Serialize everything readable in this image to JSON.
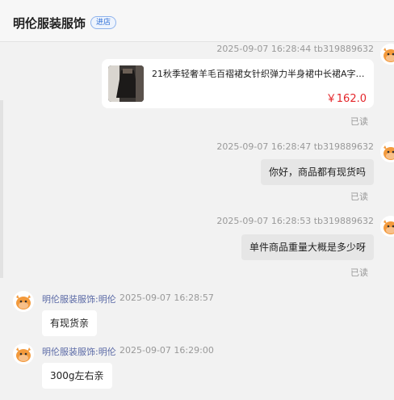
{
  "header": {
    "shop_name": "明伦服装服饰",
    "enter_shop_label": "进店"
  },
  "messages": [
    {
      "type": "product",
      "meta": "2025-09-07 16:28:44  tb319889632",
      "product_title": "21秋季轻奢羊毛百褶裙女针织弹力半身裙中长裙A字羊...",
      "price": "￥162.0",
      "read": "已读"
    },
    {
      "type": "text",
      "meta": "2025-09-07 16:28:47  tb319889632",
      "text": "你好，商品都有现货吗",
      "read": "已读"
    },
    {
      "type": "text",
      "meta": "2025-09-07 16:28:53  tb319889632",
      "text": "单件商品重量大概是多少呀",
      "read": "已读"
    },
    {
      "type": "reply",
      "sender": "明伦服装服饰:明伦",
      "time": "2025-09-07 16:28:57",
      "text": "有现货亲"
    },
    {
      "type": "reply",
      "sender": "明伦服装服饰:明伦",
      "time": "2025-09-07 16:29:00",
      "text": "300g左右亲"
    }
  ],
  "colors": {
    "price": "#e4262b",
    "sender_name": "#5b6aa6",
    "enter_shop_accent": "#2f6fd6"
  }
}
